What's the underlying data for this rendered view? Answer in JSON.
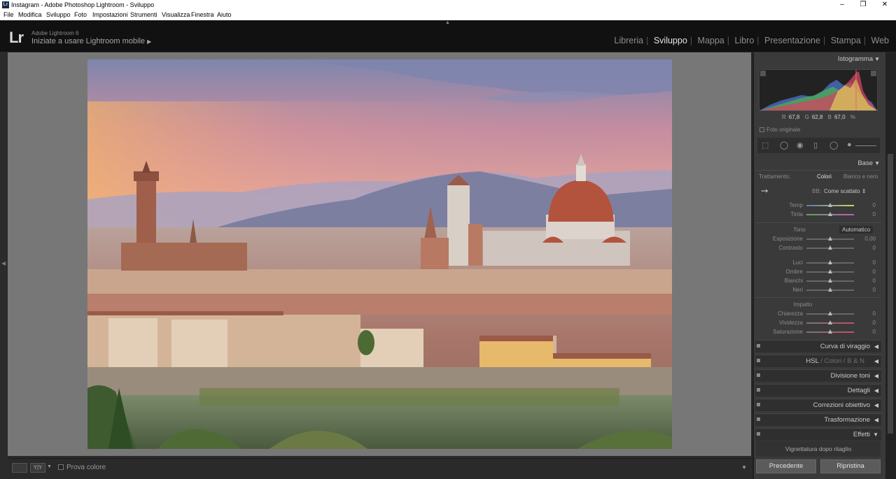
{
  "window": {
    "title": "Instagram - Adobe Photoshop Lightroom - Sviluppo",
    "app_icon": "Lr"
  },
  "menu": [
    "File",
    "Modifica",
    "Sviluppo",
    "Foto",
    "Impostazioni",
    "Strumenti",
    "Visualizza",
    "Finestra",
    "Aiuto"
  ],
  "identity": {
    "logo": "Lr",
    "version": "Adobe Lightroom 6",
    "mobile": "Iniziate a usare Lightroom mobile"
  },
  "modules": {
    "items": [
      "Libreria",
      "Sviluppo",
      "Mappa",
      "Libro",
      "Presentazione",
      "Stampa",
      "Web"
    ],
    "active": "Sviluppo"
  },
  "histogram": {
    "title": "Istogramma",
    "r_label": "R",
    "r_value": "67,8",
    "g_label": "G",
    "g_value": "62,8",
    "b_label": "B",
    "b_value": "67,0",
    "unit": "%",
    "original_label": "Foto originale"
  },
  "base": {
    "title": "Base",
    "treatment_label": "Trattamento:",
    "color_btn": "Colori",
    "bw_btn": "Bianco e nero",
    "wb_label": "BB:",
    "wb_value": "Come scattato",
    "temp_label": "Temp",
    "temp_value": "0",
    "tint_label": "Tinta",
    "tint_value": "0",
    "tone_label": "Tono",
    "auto_btn": "Automatico",
    "exposure_label": "Esposizione",
    "exposure_value": "0,00",
    "contrast_label": "Contrasto",
    "contrast_value": "0",
    "highlights_label": "Luci",
    "highlights_value": "0",
    "shadows_label": "Ombre",
    "shadows_value": "0",
    "whites_label": "Bianchi",
    "whites_value": "0",
    "blacks_label": "Neri",
    "blacks_value": "0",
    "presence_label": "Impatto",
    "clarity_label": "Chiarezza",
    "clarity_value": "0",
    "vibrance_label": "Vividezza",
    "vibrance_value": "0",
    "saturation_label": "Saturazione",
    "saturation_value": "0"
  },
  "panels": {
    "tone_curve": "Curva di viraggio",
    "hsl": "HSL",
    "hsl_color": "Colori",
    "hsl_bw": "B & N",
    "split_toning": "Divisione toni",
    "detail": "Dettagli",
    "lens": "Correzioni obiettivo",
    "transform": "Trasformazione",
    "effects": "Effetti",
    "vignette": "Vignettatura dopo ritaglio"
  },
  "footer": {
    "previous": "Precedente",
    "reset": "Ripristina",
    "soft_proof": "Prova colore"
  }
}
